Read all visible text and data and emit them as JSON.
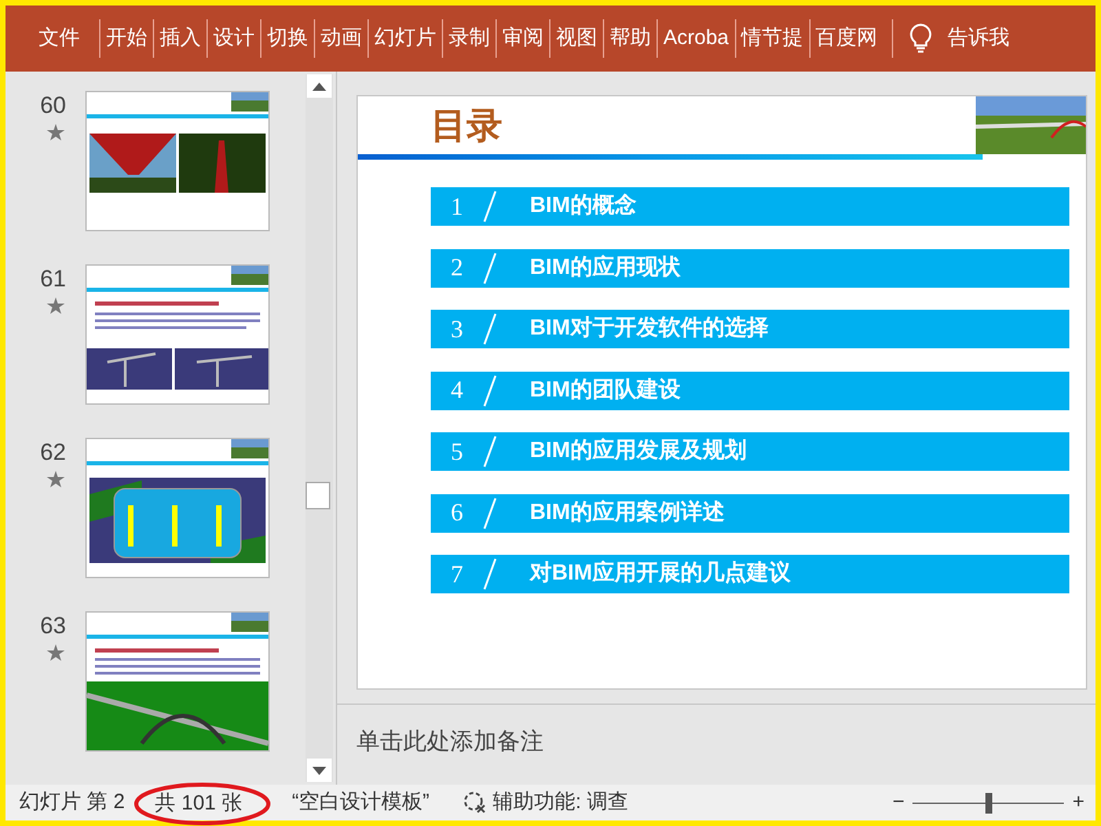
{
  "ribbon": {
    "tabs": [
      {
        "label": "文件",
        "selected": false
      },
      {
        "label": "开始",
        "selected": false
      },
      {
        "label": "插入",
        "selected": false
      },
      {
        "label": "设计",
        "selected": false
      },
      {
        "label": "切换",
        "selected": false
      },
      {
        "label": "动画",
        "selected": false
      },
      {
        "label": "幻灯片",
        "selected": false
      },
      {
        "label": "录制",
        "selected": false
      },
      {
        "label": "审阅",
        "selected": false
      },
      {
        "label": "视图",
        "selected": false
      },
      {
        "label": "帮助",
        "selected": false
      },
      {
        "label": "Acroba",
        "selected": false
      },
      {
        "label": "情节提",
        "selected": false
      },
      {
        "label": "百度网",
        "selected": false
      }
    ],
    "tell_me": "告诉我"
  },
  "thumbnails": [
    {
      "number": "60",
      "animated": true,
      "kind": "photos"
    },
    {
      "number": "61",
      "animated": true,
      "kind": "text-photos"
    },
    {
      "number": "62",
      "animated": true,
      "kind": "diagram"
    },
    {
      "number": "63",
      "animated": true,
      "kind": "text-render"
    }
  ],
  "slide": {
    "title": "目录",
    "items": [
      {
        "number": "1",
        "label": "BIM的概念"
      },
      {
        "number": "2",
        "label": "BIM的应用现状"
      },
      {
        "number": "3",
        "label": "BIM对于开发软件的选择"
      },
      {
        "number": "4",
        "label": "BIM的团队建设"
      },
      {
        "number": "5",
        "label": "BIM的应用发展及规划"
      },
      {
        "number": "6",
        "label": "BIM的应用案例详述"
      },
      {
        "number": "7",
        "label": "对BIM应用开展的几点建议"
      }
    ]
  },
  "notes": {
    "placeholder": "单击此处添加备注"
  },
  "status_bar": {
    "slide": "幻灯片 第 2",
    "total": "共 101 张",
    "template": "“空白设计模板”",
    "accessibility": "辅助功能: 调查",
    "zoom_out": "−",
    "zoom_in": "+",
    "zoom": {
      "level": 0.5
    }
  }
}
